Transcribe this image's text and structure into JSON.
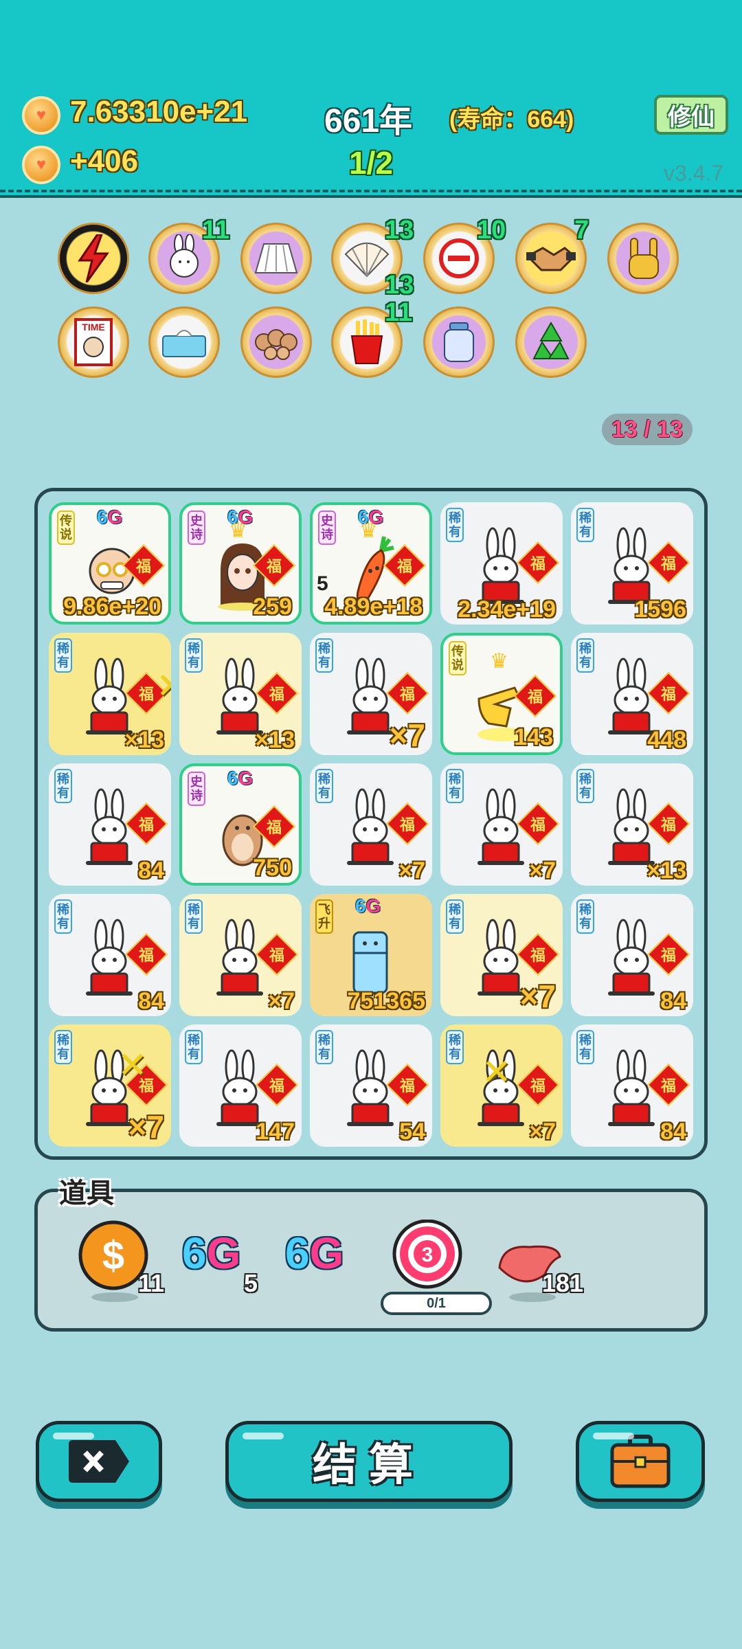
{
  "header": {
    "coins": "7.63310e+21",
    "income": "+406",
    "year": "661年",
    "lifespan": "(寿命：664)",
    "round": "1/2",
    "cultivate_label": "修仙",
    "version": "v3.4.7"
  },
  "skills": {
    "row1": [
      {
        "icon": "lightning-icon",
        "count": ""
      },
      {
        "icon": "bunny-icon",
        "count": "11"
      },
      {
        "icon": "skirt-icon",
        "count": ""
      },
      {
        "icon": "shell-icon",
        "count": "13",
        "sub_count": "13"
      },
      {
        "icon": "minus-icon",
        "count": "10"
      },
      {
        "icon": "handshake-icon",
        "count": "7"
      },
      {
        "icon": "rock-hand-icon",
        "count": ""
      }
    ],
    "row2": [
      {
        "icon": "time-magazine-icon",
        "count": ""
      },
      {
        "icon": "tissue-box-icon",
        "count": ""
      },
      {
        "icon": "hamster-family-icon",
        "count": ""
      },
      {
        "icon": "fries-icon",
        "count": "11"
      },
      {
        "icon": "jar-icon",
        "count": ""
      },
      {
        "icon": "recycle-icon",
        "count": ""
      }
    ]
  },
  "counter": "13 / 13",
  "board": {
    "tiles": [
      {
        "tag": "传说",
        "value": "9.86e+20"
      },
      {
        "tag": "史诗",
        "value": "259"
      },
      {
        "tag": "史诗",
        "value": "4.89e+18",
        "level": "5"
      },
      {
        "tag": "稀有",
        "value": "2.34e+19"
      },
      {
        "tag": "稀有",
        "value": "1596"
      },
      {
        "tag": "稀有",
        "value": "×13"
      },
      {
        "tag": "稀有",
        "value": "×13"
      },
      {
        "tag": "稀有",
        "value": "×7"
      },
      {
        "tag": "传说",
        "value": "143"
      },
      {
        "tag": "稀有",
        "value": "448"
      },
      {
        "tag": "稀有",
        "value": "84"
      },
      {
        "tag": "史诗",
        "value": "750"
      },
      {
        "tag": "稀有",
        "value": "×7"
      },
      {
        "tag": "稀有",
        "value": "×7"
      },
      {
        "tag": "稀有",
        "value": "×13"
      },
      {
        "tag": "稀有",
        "value": "84"
      },
      {
        "tag": "稀有",
        "value": "×7"
      },
      {
        "tag": "飞升",
        "value": "751365"
      },
      {
        "tag": "稀有",
        "value": "×7"
      },
      {
        "tag": "稀有",
        "value": "84"
      },
      {
        "tag": "稀有",
        "value": "×7"
      },
      {
        "tag": "稀有",
        "value": "147"
      },
      {
        "tag": "稀有",
        "value": "54"
      },
      {
        "tag": "稀有",
        "value": "×7"
      },
      {
        "tag": "稀有",
        "value": "84"
      }
    ],
    "fu_label": "福",
    "sixg_label": "6G"
  },
  "props": {
    "label": "道具",
    "coin_count": "11",
    "sixg_a": "6G",
    "sixg_a_count": "5",
    "sixg_b": "6G",
    "target_number": "3",
    "target_progress": "0/1",
    "liver_count": "181"
  },
  "buttons": {
    "settle_label": "结算"
  }
}
